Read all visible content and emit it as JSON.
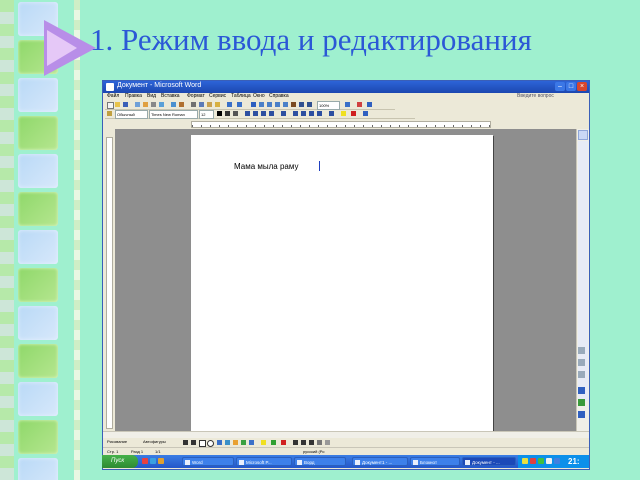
{
  "slide": {
    "title": "1. Режим ввода и редактирования"
  },
  "window": {
    "title": "Документ - Microsoft Word",
    "menu": [
      "Файл",
      "Правка",
      "Вид",
      "Вставка",
      "Формат",
      "Сервис",
      "Таблица",
      "Окно",
      "Справка"
    ],
    "help_box": "Введите вопрос",
    "style_box": "Обычный",
    "font_box": "Times New Roman",
    "size_box": "12",
    "zoom_box": "100%"
  },
  "document": {
    "text": "Мама мыла раму"
  },
  "drawbar": {
    "label": "Рисование",
    "autoshapes": "Автофигуры"
  },
  "statusbar": {
    "page": "Стр. 1",
    "section": "Разд 1",
    "pages": "1/1",
    "lang": "русский (Ро"
  },
  "taskbar": {
    "start": "Пуск",
    "tasks": [
      "Word",
      "Microsoft P...",
      "Ворд",
      "Документ1 - ...",
      "Блокнот",
      "Документ - ..."
    ],
    "clock": "21:"
  },
  "colors": {
    "title": "#2b58d6",
    "background": "#9ff0cf",
    "taskbar": "#2456c9",
    "start": "#2e8a32"
  }
}
